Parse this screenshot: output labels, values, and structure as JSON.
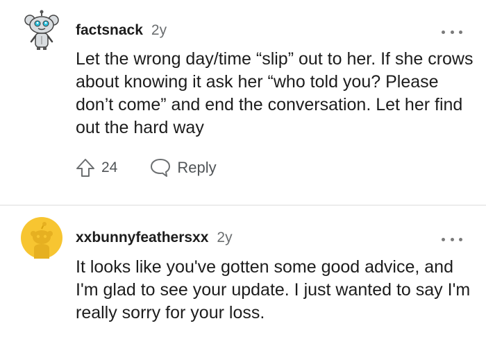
{
  "comments": [
    {
      "username": "factsnack",
      "age": "2y",
      "text": "Let the wrong day/time “slip” out to her. If she crows about knowing it ask her “who told you? Please don’t come” and end the conversation. Let her find out the hard way",
      "votes": "24",
      "reply_label": "Reply",
      "avatar_icon": "robot-snoo-avatar-icon"
    },
    {
      "username": "xxbunnyfeathersxx",
      "age": "2y",
      "text": "It looks like you've gotten some good advice, and I'm glad to see your update. I just wanted to say I'm really sorry for your loss.",
      "avatar_icon": "default-snoo-avatar-icon",
      "avatar_color": "#f7c531"
    }
  ],
  "colors": {
    "text": "#1c1c1c",
    "meta": "#6b6e70",
    "divider": "#ececec",
    "avatar_yellow": "#f7c531"
  }
}
